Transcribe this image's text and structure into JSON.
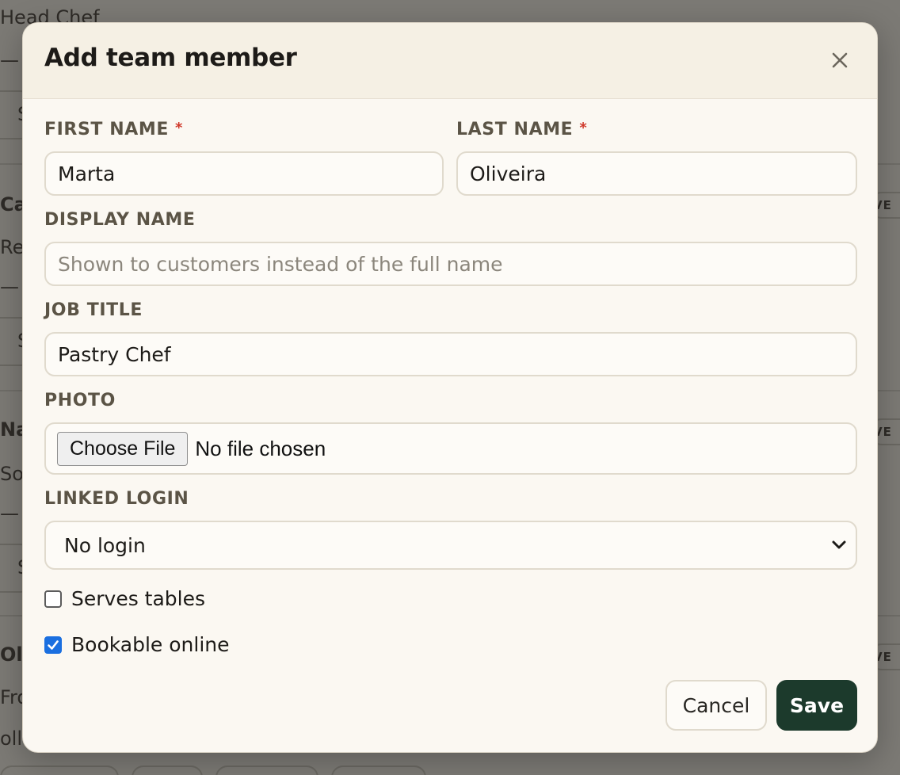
{
  "background": {
    "texts": [
      "Head Chef",
      "—",
      "S",
      "Ca",
      "Re",
      "—",
      "S",
      "Na",
      "So",
      "—",
      "S",
      "Ol",
      "Fro",
      "oll"
    ],
    "badge_text": "VE"
  },
  "modal": {
    "title": "Add team member",
    "close_label": "×",
    "fields": {
      "first_name": {
        "label": "FIRST NAME",
        "required_mark": "*",
        "value": "Marta"
      },
      "last_name": {
        "label": "LAST NAME",
        "required_mark": "*",
        "value": "Oliveira"
      },
      "display_name": {
        "label": "DISPLAY NAME",
        "value": "",
        "placeholder": "Shown to customers instead of the full name"
      },
      "job_title": {
        "label": "JOB TITLE",
        "value": "Pastry Chef"
      },
      "photo": {
        "label": "PHOTO",
        "button_label": "Choose File",
        "status": "No file chosen"
      },
      "linked_login": {
        "label": "LINKED LOGIN",
        "selected": "No login"
      }
    },
    "checkboxes": {
      "serves_tables": {
        "label": "Serves tables",
        "checked": false
      },
      "bookable_online": {
        "label": "Bookable online",
        "checked": true
      }
    },
    "buttons": {
      "cancel": "Cancel",
      "save": "Save"
    }
  },
  "colors": {
    "accent_primary": "#1c3a2c",
    "required": "#d0392b",
    "checkbox_checked": "#1a6fe0"
  }
}
